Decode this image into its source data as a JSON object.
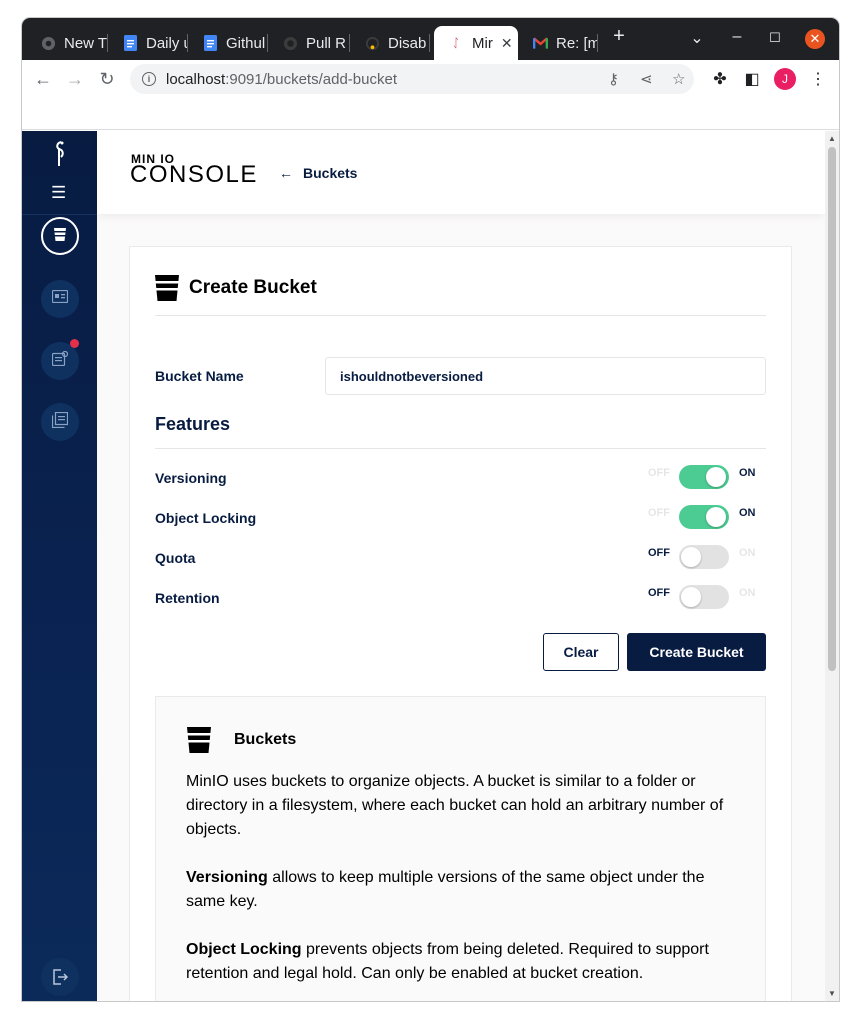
{
  "browser": {
    "tabs": [
      {
        "title": "New T",
        "icon": "chrome-icon"
      },
      {
        "title": "Daily u",
        "icon": "docs-icon"
      },
      {
        "title": "Githul",
        "icon": "docs-icon"
      },
      {
        "title": "Pull R",
        "icon": "github-icon"
      },
      {
        "title": "Disab",
        "icon": "loading-icon"
      },
      {
        "title": "Mir",
        "icon": "minio-icon",
        "active": true
      },
      {
        "title": "Re: [m",
        "icon": "gmail-icon"
      }
    ],
    "url_host": "localhost",
    "url_path": ":9091/buckets/add-bucket",
    "profile_initial": "J"
  },
  "header": {
    "logo_top": "MIN IO",
    "logo_bottom": "CONSOLE",
    "back_label": "Buckets"
  },
  "form": {
    "title": "Create Bucket",
    "bucket_name_label": "Bucket Name",
    "bucket_name_value": "ishouldnotbeversioned",
    "features_title": "Features",
    "off_label": "OFF",
    "on_label": "ON",
    "toggles": [
      {
        "label": "Versioning",
        "state": "on"
      },
      {
        "label": "Object Locking",
        "state": "on"
      },
      {
        "label": "Quota",
        "state": "off"
      },
      {
        "label": "Retention",
        "state": "off"
      }
    ],
    "clear_label": "Clear",
    "create_label": "Create Bucket"
  },
  "help": {
    "title": "Buckets",
    "intro": "MinIO uses buckets to organize objects. A bucket is similar to a folder or directory in a filesystem, where each bucket can hold an arbitrary number of objects.",
    "versioning_term": "Versioning",
    "versioning_text": " allows to keep multiple versions of the same object under the same key.",
    "locking_term": "Object Locking",
    "locking_text": " prevents objects from being deleted. Required to support retention and legal hold. Can only be enabled at bucket creation."
  },
  "colors": {
    "sidebar": "#081c42",
    "toggle_on": "#4ccb92",
    "primary_button": "#081c42",
    "notification_dot": "#e5304c"
  }
}
